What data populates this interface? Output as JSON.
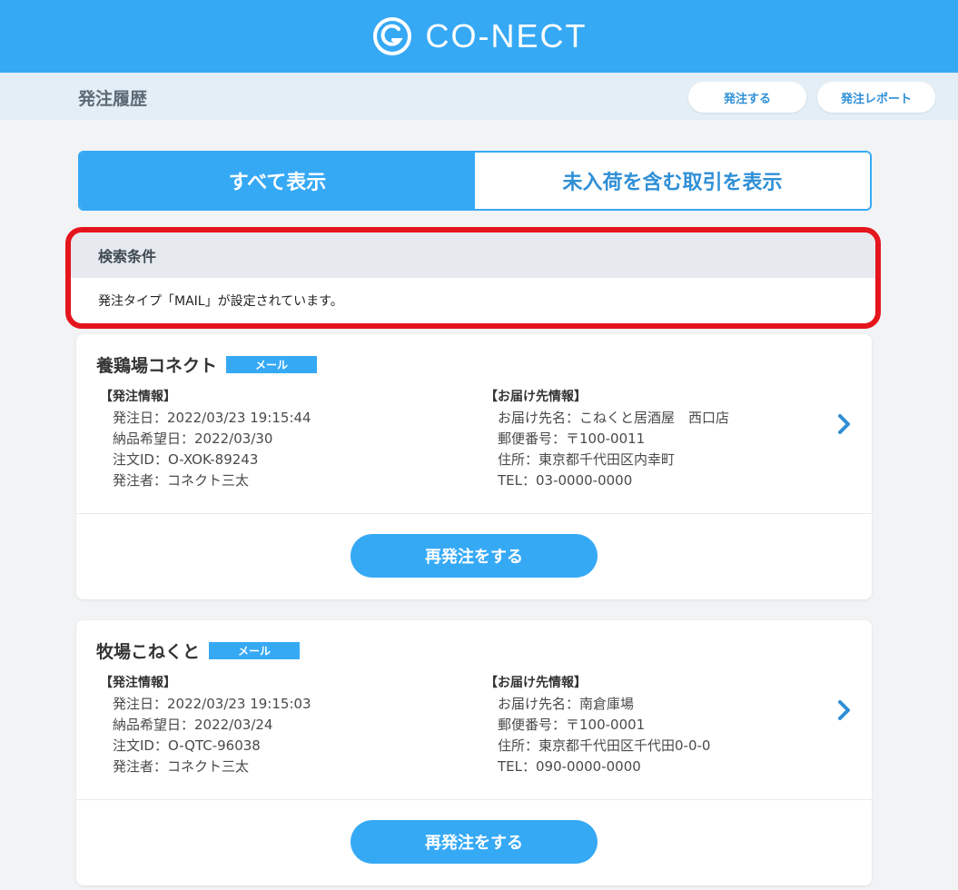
{
  "header": {
    "logo_text": "CO-NECT",
    "logo_icon": "conect-logo-icon"
  },
  "subheader": {
    "title": "発注履歴",
    "order_button": "発注する",
    "report_button": "発注レポート"
  },
  "tabs": [
    {
      "label": "すべて表示",
      "active": true
    },
    {
      "label": "未入荷を含む取引を表示",
      "active": false
    }
  ],
  "search": {
    "heading": "検索条件",
    "condition": "発注タイプ「MAIL」が設定されています。"
  },
  "orders": [
    {
      "supplier": "養鶏場コネクト",
      "type_badge": "メール",
      "order_info_title": "【発注情報】",
      "order_date": "発注日：2022/03/23 19:15:44",
      "delivery_date": "納品希望日：2022/03/30",
      "order_id": "注文ID：O-XOK-89243",
      "orderer": "発注者：コネクト三太",
      "dest_info_title": "【お届け先情報】",
      "dest_name": "お届け先名：こねくと居酒屋　西口店",
      "postal": "郵便番号：〒100-0011",
      "address": "住所：東京都千代田区内幸町",
      "tel": "TEL：03-0000-0000",
      "reorder": "再発注をする"
    },
    {
      "supplier": "牧場こねくと",
      "type_badge": "メール",
      "order_info_title": "【発注情報】",
      "order_date": "発注日：2022/03/23 19:15:03",
      "delivery_date": "納品希望日：2022/03/24",
      "order_id": "注文ID：O-QTC-96038",
      "orderer": "発注者：コネクト三太",
      "dest_info_title": "【お届け先情報】",
      "dest_name": "お届け先名：南倉庫場",
      "postal": "郵便番号：〒100-0001",
      "address": "住所：東京都千代田区千代田0-0-0",
      "tel": "TEL：090-0000-0000",
      "reorder": "再発注をする"
    }
  ],
  "colors": {
    "brand": "#36a9f5",
    "highlight": "#e5151d"
  }
}
